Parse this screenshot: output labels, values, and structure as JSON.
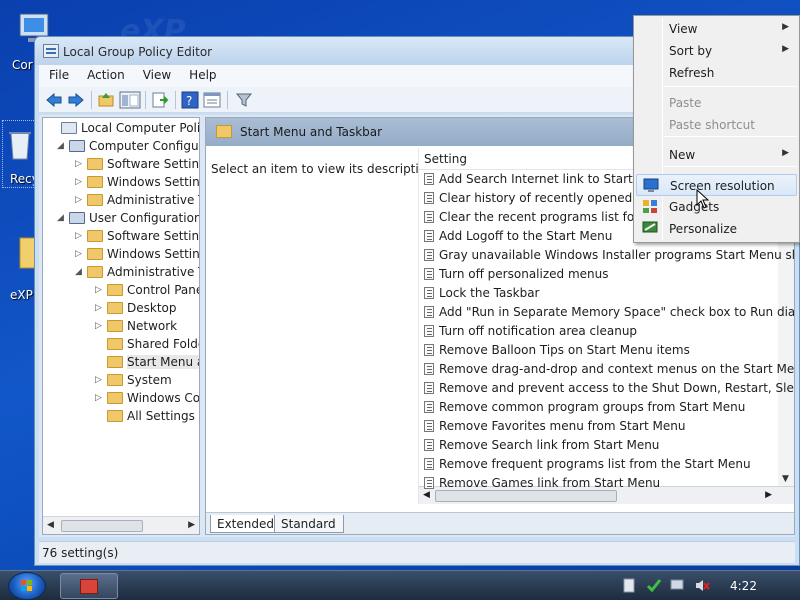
{
  "desktop": {
    "icons": [
      {
        "label": "Cor"
      },
      {
        "label": "Recy"
      },
      {
        "label": "eXP"
      }
    ]
  },
  "window": {
    "title": "Local Group Policy Editor",
    "menu": [
      {
        "label": "File",
        "accel": "F",
        "rest": "ile"
      },
      {
        "label": "Action",
        "accel": "A",
        "rest": "ction"
      },
      {
        "label": "View",
        "accel": "V",
        "rest": "iew"
      },
      {
        "label": "Help",
        "accel": "H",
        "rest": "elp"
      }
    ],
    "toolbar_icons": [
      "back-arrow-icon",
      "forward-arrow-icon",
      "up-folder-icon",
      "show-hide-tree-icon",
      "export-list-icon",
      "help-icon",
      "properties-icon",
      "filter-icon"
    ]
  },
  "tree": {
    "items": [
      {
        "label": "Local Computer Policy",
        "level": 0,
        "arrow": ""
      },
      {
        "label": "Computer Configura",
        "level": 1,
        "arrow": "open"
      },
      {
        "label": "Software Settings",
        "level": 2,
        "arrow": "closed"
      },
      {
        "label": "Windows Setting",
        "level": 2,
        "arrow": "closed"
      },
      {
        "label": "Administrative Te",
        "level": 2,
        "arrow": "closed"
      },
      {
        "label": "User Configuration",
        "level": 1,
        "arrow": "open"
      },
      {
        "label": "Software Settings",
        "level": 2,
        "arrow": "closed"
      },
      {
        "label": "Windows Setting",
        "level": 2,
        "arrow": "closed"
      },
      {
        "label": "Administrative Te",
        "level": 2,
        "arrow": "open"
      },
      {
        "label": "Control Panel",
        "level": 3,
        "arrow": "closed"
      },
      {
        "label": "Desktop",
        "level": 3,
        "arrow": "closed"
      },
      {
        "label": "Network",
        "level": 3,
        "arrow": "closed"
      },
      {
        "label": "Shared Folder",
        "level": 3,
        "arrow": ""
      },
      {
        "label": "Start Menu ar",
        "level": 3,
        "arrow": "",
        "selected": true
      },
      {
        "label": "System",
        "level": 3,
        "arrow": "closed"
      },
      {
        "label": "Windows Cor",
        "level": 3,
        "arrow": "closed"
      },
      {
        "label": "All Settings",
        "level": 3,
        "arrow": ""
      }
    ]
  },
  "details": {
    "header_title": "Start Menu and Taskbar",
    "description_prompt": "Select an item to view its description.",
    "column_header": "Setting",
    "settings": [
      "Add Search Internet link to Start Menu",
      "Clear history of recently opened docu",
      "Clear the recent programs list for new",
      "Add Logoff to the Start Menu",
      "Gray unavailable Windows Installer programs Start Menu sh...",
      "Turn off personalized menus",
      "Lock the Taskbar",
      "Add \"Run in Separate Memory Space\" check box to Run dial...",
      "Turn off notification area cleanup",
      "Remove Balloon Tips on Start Menu items",
      "Remove drag-and-drop and context menus on the Start Me...",
      "Remove and prevent access to the Shut Down, Restart, Sleep...",
      "Remove common program groups from Start Menu",
      "Remove Favorites menu from Start Menu",
      "Remove Search link from Start Menu",
      "Remove frequent programs list from the Start Menu",
      "Remove Games link from Start Menu"
    ],
    "tabs": [
      "Extended",
      "Standard"
    ],
    "active_tab": "Extended"
  },
  "status": {
    "text": "76 setting(s)"
  },
  "context_menu": {
    "items": [
      {
        "label": "View",
        "accel_prefix": "",
        "accel": "V",
        "rest": "iew",
        "submenu": true,
        "disabled": false
      },
      {
        "label": "Sort by",
        "accel_prefix": "S",
        "accel": "o",
        "rest": "rt by",
        "submenu": true,
        "disabled": false
      },
      {
        "label": "Refresh",
        "accel_prefix": "R",
        "accel": "e",
        "rest": "fresh",
        "submenu": false,
        "disabled": false
      },
      {
        "label": "Paste",
        "accel_prefix": "",
        "accel": "P",
        "rest": "aste",
        "submenu": false,
        "disabled": true
      },
      {
        "label": "Paste shortcut",
        "accel_prefix": "Paste ",
        "accel": "s",
        "rest": "hortcut",
        "submenu": false,
        "disabled": true
      },
      {
        "label": "New",
        "accel_prefix": "Ne",
        "accel": "w",
        "rest": "",
        "submenu": true,
        "disabled": false
      },
      {
        "label": "Screen resolution",
        "accel_prefix": "",
        "accel": "C",
        "rest": "",
        "submenu": false,
        "disabled": false,
        "hot": true,
        "icon": "monitor-icon"
      },
      {
        "label": "Gadgets",
        "accel_prefix": "",
        "accel": "G",
        "rest": "adgets",
        "submenu": false,
        "disabled": false,
        "icon": "gadgets-icon"
      },
      {
        "label": "Personalize",
        "accel_prefix": "",
        "accel": "R",
        "rest": "",
        "submenu": false,
        "disabled": false,
        "icon": "personalize-icon"
      }
    ],
    "submenu_arrow": "▶"
  },
  "taskbar": {
    "clock": "4:22",
    "tray_icons": [
      "action-center-icon",
      "network-icon",
      "display-icon",
      "volume-muted-icon"
    ]
  },
  "colors": {
    "desktop": "#1257c9",
    "window_frame": "#c9dff3",
    "selection": "#d9e8f8",
    "taskbar": "#2a3a50"
  }
}
